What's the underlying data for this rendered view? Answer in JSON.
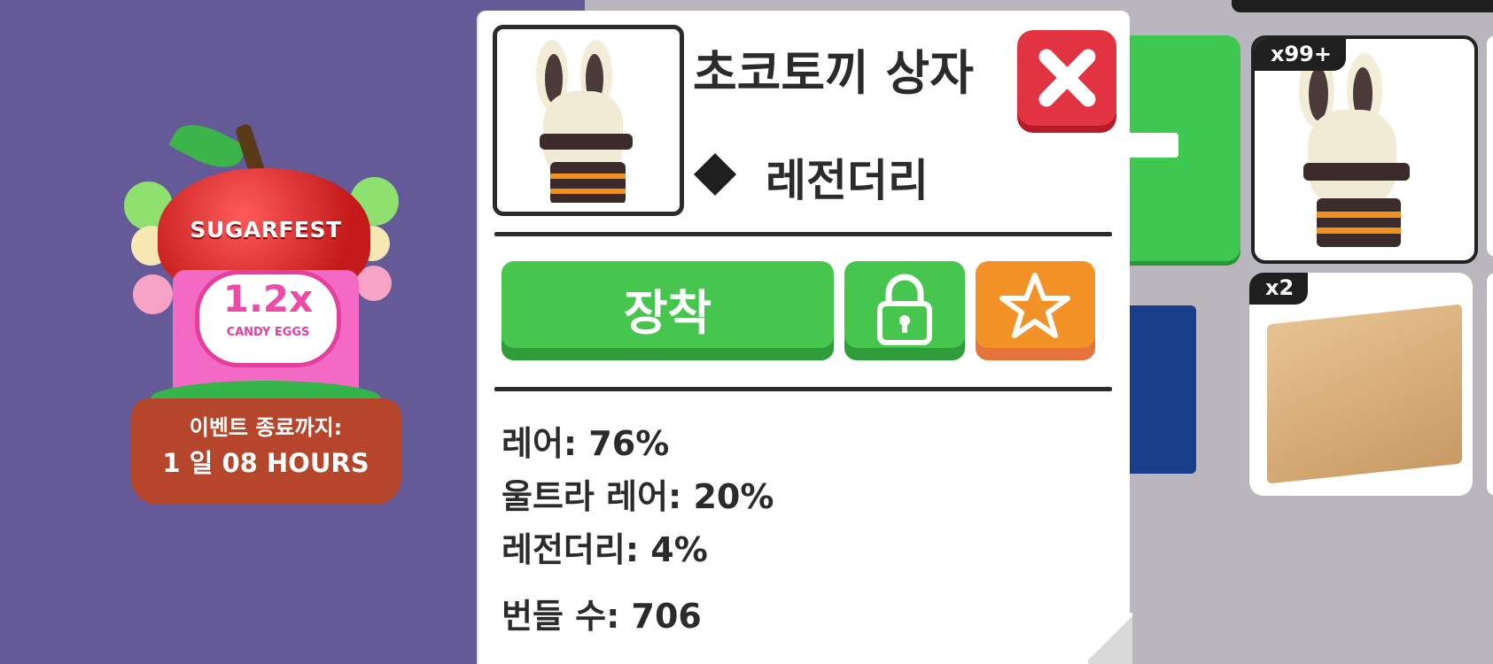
{
  "event": {
    "title": "SUGARFEST",
    "multiplier": "1.2x",
    "multiplier_sub": "CANDY EGGS",
    "ends_label": "이벤트 종료까지:",
    "time_left": "1 일 08 HOURS"
  },
  "item": {
    "name": "초코토끼 상자",
    "rarity": "레전더리",
    "equip_label": "장착"
  },
  "stats": [
    {
      "label": "레어: 76%"
    },
    {
      "label": "울트라 레어: 20%"
    },
    {
      "label": "레전더리: 4%"
    },
    {
      "label": "번들 수: 706"
    }
  ],
  "inventory": {
    "tile1_count": "x99+",
    "tile2_count": "x2"
  },
  "colors": {
    "background_left": "#645a98",
    "equip_green": "#47c64f",
    "star_orange": "#f39226",
    "close_red": "#e23343"
  }
}
